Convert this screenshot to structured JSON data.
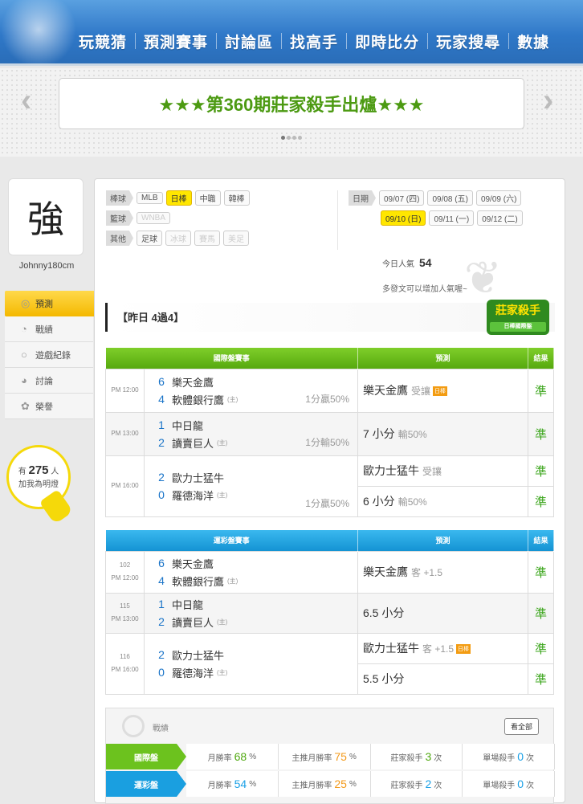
{
  "nav": {
    "items": [
      "玩競猜",
      "預測賽事",
      "討論區",
      "找高手",
      "即時比分",
      "玩家搜尋",
      "數據"
    ]
  },
  "banner": {
    "text": "★★★第360期莊家殺手出爐★★★",
    "prev": "‹",
    "next": "›"
  },
  "profile": {
    "avatar_text": "強",
    "username": "Johnny180cm"
  },
  "side_menu": [
    {
      "label": "預測",
      "icon": "target-icon",
      "glyph": "◎"
    },
    {
      "label": "戰績",
      "icon": "chart-icon",
      "glyph": "◔"
    },
    {
      "label": "遊戲紀錄",
      "icon": "record-icon",
      "glyph": "○"
    },
    {
      "label": "討論",
      "icon": "chat-icon",
      "glyph": "◕"
    },
    {
      "label": "榮譽",
      "icon": "medal-icon",
      "glyph": "✿"
    }
  ],
  "fans": {
    "prefix": "有",
    "count": "275",
    "suffix": "人",
    "text": "加我為明燈"
  },
  "filters": {
    "baseball": {
      "tag": "棒球",
      "chips": [
        "MLB",
        "日棒",
        "中職",
        "韓棒"
      ],
      "selected": "日棒"
    },
    "basketball": {
      "tag": "籃球",
      "chips": [
        "WNBA"
      ]
    },
    "other": {
      "tag": "其他",
      "chips": [
        "足球",
        "冰球",
        "賽馬",
        "美足"
      ]
    },
    "date": {
      "tag": "日期",
      "row1": [
        "09/07 (四)",
        "09/08 (五)",
        "09/09 (六)"
      ],
      "row2": [
        "09/10 (日)",
        "09/11 (一)",
        "09/12 (二)"
      ],
      "selected": "09/10 (日)"
    }
  },
  "popular": {
    "label": "今日人氣",
    "value": "54",
    "hint": "多發文可以增加人氣喔~"
  },
  "yesterday": "【昨日 4過4】",
  "badge": {
    "title": "莊家殺手",
    "sub": "日棒國際盤"
  },
  "intl": {
    "headers": [
      "國際盤賽事",
      "預測",
      "結果"
    ],
    "rows": [
      {
        "time": "PM 12:00",
        "s1": "6",
        "t1": "樂天金鷹",
        "s2": "4",
        "t2": "軟體銀行鷹",
        "home": "(主)",
        "odds": "1分贏50%",
        "preds": [
          {
            "main": "樂天金鷹",
            "gray": "受讓",
            "tag": "日棒",
            "res": "準"
          }
        ]
      },
      {
        "time": "PM 13:00",
        "s1": "1",
        "t1": "中日龍",
        "s2": "2",
        "t2": "讀賣巨人",
        "home": "(主)",
        "odds": "1分輸50%",
        "preds": [
          {
            "main": "7 小分",
            "gray": "輸50%",
            "res": "準"
          }
        ]
      },
      {
        "time": "PM 16:00",
        "s1": "2",
        "t1": "歐力士猛牛",
        "s2": "0",
        "t2": "羅德海洋",
        "home": "(主)",
        "odds": "1分贏50%",
        "preds": [
          {
            "main": "歐力士猛牛",
            "gray": "受讓",
            "res": "準"
          },
          {
            "main": "6 小分",
            "gray": "輸50%",
            "res": "準"
          }
        ]
      }
    ]
  },
  "lottery": {
    "headers": [
      "運彩盤賽事",
      "預測",
      "結果"
    ],
    "rows": [
      {
        "code": "102",
        "time": "PM 12:00",
        "s1": "6",
        "t1": "樂天金鷹",
        "s2": "4",
        "t2": "軟體銀行鷹",
        "home": "(主)",
        "preds": [
          {
            "main": "樂天金鷹",
            "gray": "客 +1.5",
            "res": "準"
          }
        ]
      },
      {
        "code": "115",
        "time": "PM 13:00",
        "s1": "1",
        "t1": "中日龍",
        "s2": "2",
        "t2": "讀賣巨人",
        "home": "(主)",
        "preds": [
          {
            "main": "6.5 小分",
            "gray": "",
            "res": "準"
          }
        ]
      },
      {
        "code": "116",
        "time": "PM 16:00",
        "s1": "2",
        "t1": "歐力士猛牛",
        "s2": "0",
        "t2": "羅德海洋",
        "home": "(主)",
        "preds": [
          {
            "main": "歐力士猛牛",
            "gray": "客 +1.5",
            "tag": "日棒",
            "res": "準"
          },
          {
            "main": "5.5 小分",
            "gray": "",
            "res": "準"
          }
        ]
      }
    ]
  },
  "stats": {
    "title": "戰績",
    "see_all": "看全部",
    "rows": [
      {
        "label": "國際盤",
        "color": "#6cc21e",
        "cells": [
          {
            "k": "月勝率",
            "v": "68",
            "u": "%",
            "c": "green"
          },
          {
            "k": "主推月勝率",
            "v": "75",
            "u": "%",
            "c": "orange"
          },
          {
            "k": "莊家殺手",
            "v": "3",
            "u": "次",
            "c": "green"
          },
          {
            "k": "單場殺手",
            "v": "0",
            "u": "次",
            "c": "blue"
          }
        ]
      },
      {
        "label": "運彩盤",
        "color": "#1a9fe0",
        "cells": [
          {
            "k": "月勝率",
            "v": "54",
            "u": "%",
            "c": "blue"
          },
          {
            "k": "主推月勝率",
            "v": "25",
            "u": "%",
            "c": "orange"
          },
          {
            "k": "莊家殺手",
            "v": "2",
            "u": "次",
            "c": "blue"
          },
          {
            "k": "單場殺手",
            "v": "0",
            "u": "次",
            "c": "blue"
          }
        ]
      }
    ]
  }
}
